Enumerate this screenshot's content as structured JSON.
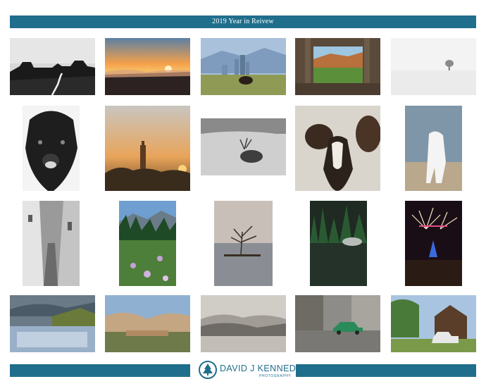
{
  "header": {
    "title": "2019 Year in Reivew"
  },
  "footer": {
    "brand_name": "DAVID J KENNEDY",
    "brand_sub": "PHOTOGRAPHY",
    "brand_color": "#1f6e8c"
  },
  "photos": [
    {
      "subject": "monument-valley-road"
    },
    {
      "subject": "sunset-over-clouds"
    },
    {
      "subject": "denver-skyline-bison"
    },
    {
      "subject": "cabin-window-view"
    },
    {
      "subject": "lone-tree-snowfield"
    },
    {
      "subject": "bison-portrait"
    },
    {
      "subject": "marrakech-minaret-sunset"
    },
    {
      "subject": "elk-in-grass"
    },
    {
      "subject": "goats-closeup"
    },
    {
      "subject": "mountain-goat"
    },
    {
      "subject": "narrow-alley"
    },
    {
      "subject": "wildflowers-meadow"
    },
    {
      "subject": "tree-in-lake"
    },
    {
      "subject": "forest-reflection"
    },
    {
      "subject": "fireworks"
    },
    {
      "subject": "blue-town-chefchaouen"
    },
    {
      "subject": "desert-village"
    },
    {
      "subject": "misty-hills-lake"
    },
    {
      "subject": "vintage-car-street"
    },
    {
      "subject": "old-house-truck"
    }
  ]
}
